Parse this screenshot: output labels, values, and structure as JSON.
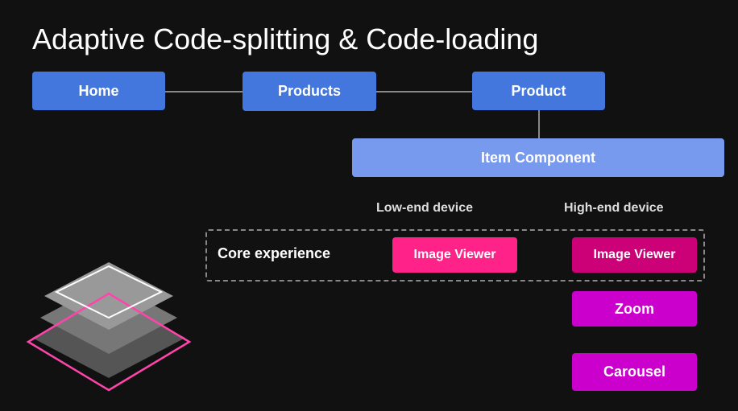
{
  "title": "Adaptive Code-splitting & Code-loading",
  "routes": {
    "home": "Home",
    "products": "Products",
    "product": "Product"
  },
  "item_component": "Item Component",
  "device_labels": {
    "lowend": "Low-end device",
    "highend": "High-end device"
  },
  "core_experience": "Core experience",
  "image_viewer": "Image Viewer",
  "zoom": "Zoom",
  "carousel": "Carousel"
}
